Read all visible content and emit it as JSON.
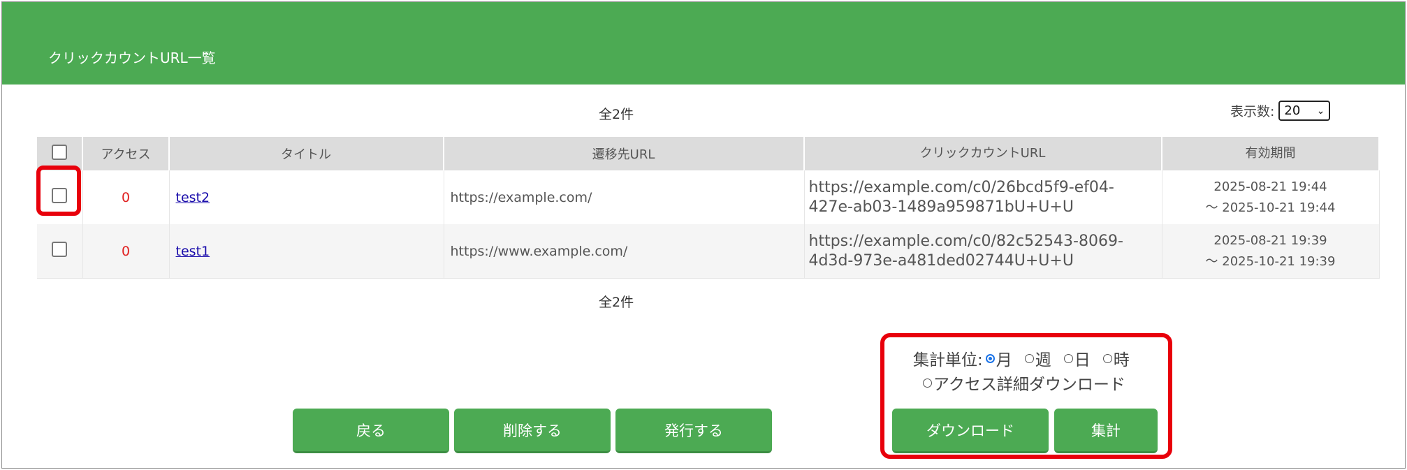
{
  "header": {
    "title": "クリックカウントURL一覧"
  },
  "summary": {
    "total_top": "全2件",
    "total_bottom": "全2件"
  },
  "display_count": {
    "label": "表示数:",
    "selected": "20"
  },
  "table": {
    "columns": [
      "アクセス",
      "タイトル",
      "遷移先URL",
      "クリックカウントURL",
      "有効期間"
    ],
    "rows": [
      {
        "access": "0",
        "title": "test2",
        "destination_url": "https://example.com/",
        "click_url_line1": "https://example.com/c0/26bcd5f9-ef04-",
        "click_url_line2": "427e-ab03-1489a959871bU+U+U",
        "valid_from": "2025-08-21 19:44",
        "valid_to": "～ 2025-10-21 19:44"
      },
      {
        "access": "0",
        "title": "test1",
        "destination_url": "https://www.example.com/",
        "click_url_line1": "https://example.com/c0/82c52543-8069-",
        "click_url_line2": "4d3d-973e-a481ded02744U+U+U",
        "valid_from": "2025-08-21 19:39",
        "valid_to": "～ 2025-10-21 19:39"
      }
    ]
  },
  "aggregation": {
    "unit_label": "集計単位:",
    "options": [
      "月",
      "週",
      "日",
      "時"
    ],
    "selected": "月",
    "detail_download": "アクセス詳細ダウンロード"
  },
  "buttons": {
    "back": "戻る",
    "delete": "削除する",
    "issue": "発行する",
    "download": "ダウンロード",
    "aggregate": "集計"
  },
  "colors": {
    "header_green": "#4caa53",
    "highlight_red": "#e8000b",
    "access_red": "#e02020",
    "link_blue": "#1a0dab"
  }
}
